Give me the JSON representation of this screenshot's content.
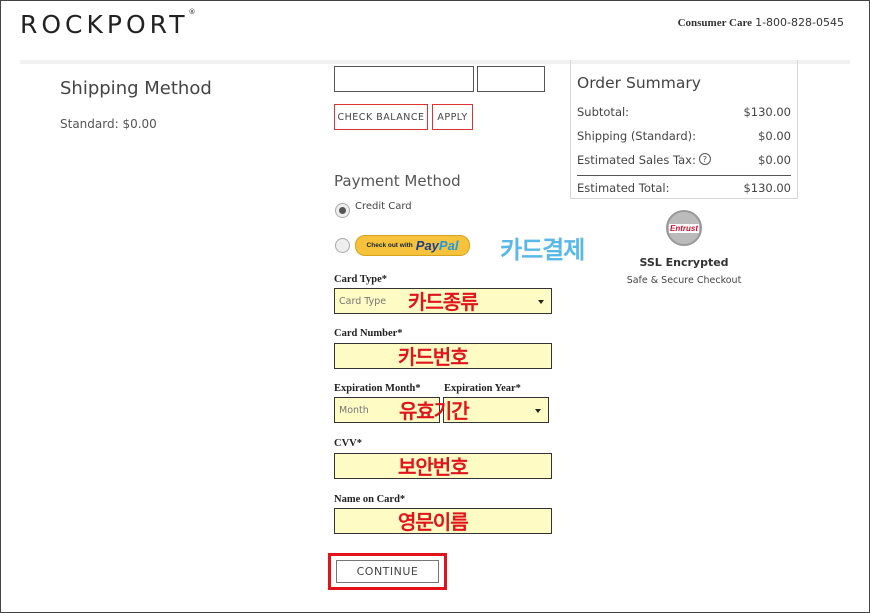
{
  "header": {
    "logo": "ROCKPORT",
    "logo_mark": "®",
    "consumer_care_label": "Consumer Care",
    "consumer_care_phone": "1-800-828-0545"
  },
  "shipping": {
    "title": "Shipping Method",
    "value": "Standard: $0.00"
  },
  "gift_card": {
    "check_balance_label": "CHECK BALANCE",
    "apply_label": "APPLY"
  },
  "order_summary": {
    "title": "Order Summary",
    "rows": [
      {
        "label": "Subtotal:",
        "value": "$130.00"
      },
      {
        "label": "Shipping (Standard):",
        "value": "$0.00"
      },
      {
        "label": "Estimated Sales Tax:",
        "value": "$0.00"
      }
    ],
    "total": {
      "label": "Estimated Total:",
      "value": "$130.00"
    },
    "help_icon": "?"
  },
  "payment": {
    "title": "Payment Method",
    "credit_card_label": "Credit Card",
    "paypal_prefix": "Check out with",
    "paypal_pay": "Pay",
    "paypal_pal": "Pal",
    "selected": "credit_card"
  },
  "annotations": {
    "card_payment": "카드결제",
    "card_type": "카드종류",
    "card_number": "카드번호",
    "expiration": "유효기간",
    "cvv": "보안번호",
    "name": "영문이름"
  },
  "ssl": {
    "badge_text": "Entrust",
    "title": "SSL Encrypted",
    "subtitle": "Safe & Secure Checkout"
  },
  "form": {
    "card_type_label": "Card Type*",
    "card_type_placeholder": "Card Type",
    "card_number_label": "Card Number*",
    "exp_month_label": "Expiration Month*",
    "exp_month_placeholder": "Month",
    "exp_year_label": "Expiration Year*",
    "cvv_label": "CVV*",
    "name_label": "Name on Card*"
  },
  "continue_label": "CONTINUE",
  "colors": {
    "highlight_field": "#fefbc5",
    "annotation_red": "#e0141a",
    "annotation_blue": "#5ab8e8",
    "accent_border": "#e3131b"
  }
}
